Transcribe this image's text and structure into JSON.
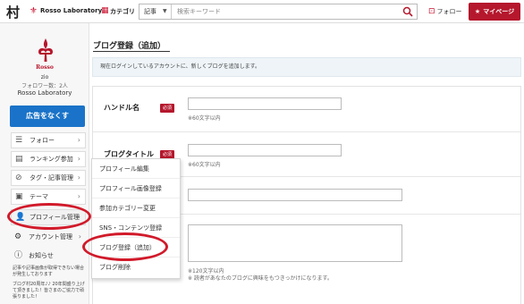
{
  "header": {
    "logo_text": "村",
    "brand_name": "Rosso Laboratory",
    "category_label": "カテゴリ",
    "search_scope": "記事",
    "search_placeholder": "検索キーワード",
    "follow_label": "フォロー",
    "mypage_label": "マイページ",
    "accent_color": "#b5172c",
    "icons": [
      "fleur-de-lis-icon",
      "grid-icon",
      "chevron-down-icon",
      "search-icon",
      "follow-icon",
      "star-icon"
    ]
  },
  "sidebar": {
    "logo_word": "Rosso",
    "user_name": "zio",
    "follower_count": "フォロワー数：2人",
    "blog_name": "Rosso Laboratory",
    "remove_ads_label": "広告をなくす",
    "menu": [
      {
        "label": "フォロー",
        "icon": "list-icon"
      },
      {
        "label": "ランキング参加",
        "icon": "ranking-icon"
      },
      {
        "label": "タグ・記事管理",
        "icon": "tag-icon"
      },
      {
        "label": "テーマ",
        "icon": "theme-icon"
      },
      {
        "label": "プロフィール管理",
        "icon": "profile-icon"
      },
      {
        "label": "アカウント管理",
        "icon": "gear-icon"
      },
      {
        "label": "お知らせ",
        "icon": "info-icon"
      }
    ],
    "news_1": "記事や記事画像が取得できない場合が発生しております",
    "news_2": "ブログ村20周年♪♪ 20年間盛り上げて頂きました！皆さまのご協力で頑張りました！"
  },
  "main": {
    "page_title": "ブログ登録（追加）",
    "info_text": "現在ログインしているアカウントに、新しくブログを追加します。",
    "required_label": "必須",
    "fields": [
      {
        "label": "ハンドル名",
        "hint": "※60文字以内"
      },
      {
        "label": "ブログタイトル",
        "hint": "※60文字以内"
      },
      {
        "label": "",
        "hint": ""
      },
      {
        "label": "",
        "hint": "※120文字以内\n※ 読者があなたのブログに興味をもつきっかけになります。"
      }
    ]
  },
  "dropdown": {
    "items": [
      "プロフィール編集",
      "プロフィール画像登録",
      "参加カテゴリー変更",
      "SNS・コンテンツ登録",
      "ブログ登録（追加）",
      "ブログ削除"
    ]
  },
  "annotation_color": "#d11a2a"
}
